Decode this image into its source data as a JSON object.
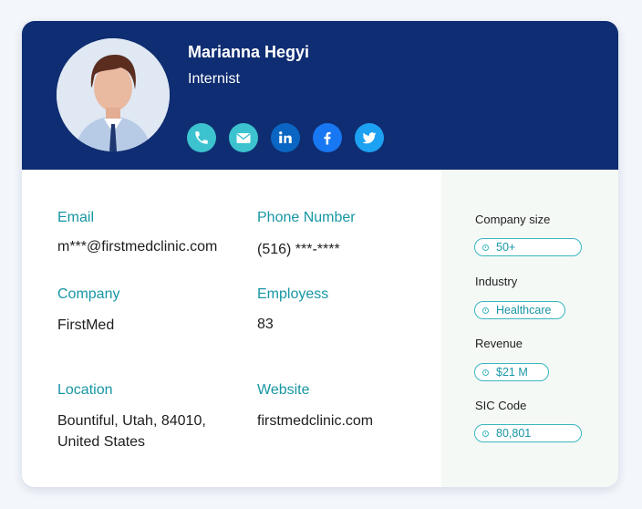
{
  "profile": {
    "name": "Marianna Hegyi",
    "title": "Internist",
    "avatar_icon": "person-portrait"
  },
  "socials": [
    {
      "icon": "phone-icon",
      "color": "#3cc3cf"
    },
    {
      "icon": "email-icon",
      "color": "#3cc3cf"
    },
    {
      "icon": "linkedin-icon",
      "color": "#0a66c2"
    },
    {
      "icon": "facebook-icon",
      "color": "#1877f2"
    },
    {
      "icon": "twitter-icon",
      "color": "#1da1f2"
    }
  ],
  "details": {
    "email": {
      "label": "Email",
      "value": "m***@firstmedclinic.com"
    },
    "phone": {
      "label": "Phone Number",
      "value": "(516) ***-****"
    },
    "company": {
      "label": "Company",
      "value": "FirstMed"
    },
    "employees": {
      "label": "Employess",
      "value": "83"
    },
    "location": {
      "label": "Location",
      "value_line1": "Bountiful, Utah, 84010,",
      "value_line2": "United States"
    },
    "website": {
      "label": "Website",
      "value": "firstmedclinic.com"
    }
  },
  "sidebar": {
    "company_size": {
      "label": "Company size",
      "value": "50+"
    },
    "industry": {
      "label": "Industry",
      "value": "Healthcare"
    },
    "revenue": {
      "label": "Revenue",
      "value": "$21 M"
    },
    "sic_code": {
      "label": "SIC Code",
      "value": "80,801"
    }
  },
  "colors": {
    "header_bg": "#0f2d72",
    "accent": "#1796a4",
    "chip_border": "#3ab6bf",
    "sidebar_bg": "#f5f9f6"
  }
}
